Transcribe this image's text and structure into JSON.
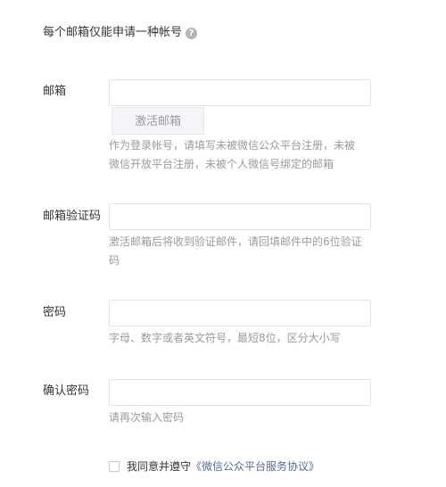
{
  "notice": {
    "text": "每个邮箱仅能申请一种帐号",
    "help_icon": "?"
  },
  "email": {
    "label": "邮箱",
    "value": "",
    "placeholder": "",
    "activate_button": "激活邮箱",
    "hint": "作为登录帐号，请填写未被微信公众平台注册，未被微信开放平台注册，未被个人微信号绑定的邮箱"
  },
  "verification_code": {
    "label": "邮箱验证码",
    "value": "",
    "placeholder": "",
    "hint": "激活邮箱后将收到验证邮件，请回填邮件中的6位验证码"
  },
  "password": {
    "label": "密码",
    "value": "",
    "placeholder": "",
    "hint": "字母、数字或者英文符号，最短8位，区分大小写"
  },
  "confirm_password": {
    "label": "确认密码",
    "value": "",
    "placeholder": "",
    "hint": "请再次输入密码"
  },
  "agreement": {
    "checked": false,
    "prefix": "我同意并遵守",
    "link": "《微信公众平台服务协议》"
  },
  "colors": {
    "link": "#576b95",
    "hint": "#9a9a9a",
    "text": "#353535",
    "border": "#e3e3e3"
  }
}
